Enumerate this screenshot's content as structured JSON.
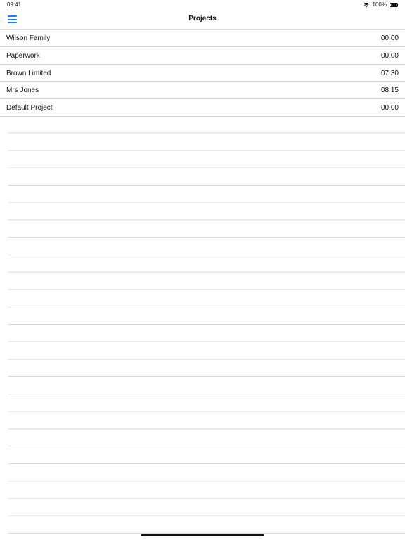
{
  "status_bar": {
    "time": "09:41",
    "battery_percent": "100%",
    "battery_level": 1.0
  },
  "nav": {
    "title": "Projects",
    "menu_icon": "hamburger-menu-icon",
    "accent_color": "#1e7ef0"
  },
  "projects": [
    {
      "name": "Wilson Family",
      "time": "00:00"
    },
    {
      "name": "Paperwork",
      "time": "00:00"
    },
    {
      "name": "Brown Limited",
      "time": "07:30"
    },
    {
      "name": "Mrs Jones",
      "time": "08:15"
    },
    {
      "name": "Default Project",
      "time": "00:00"
    }
  ]
}
